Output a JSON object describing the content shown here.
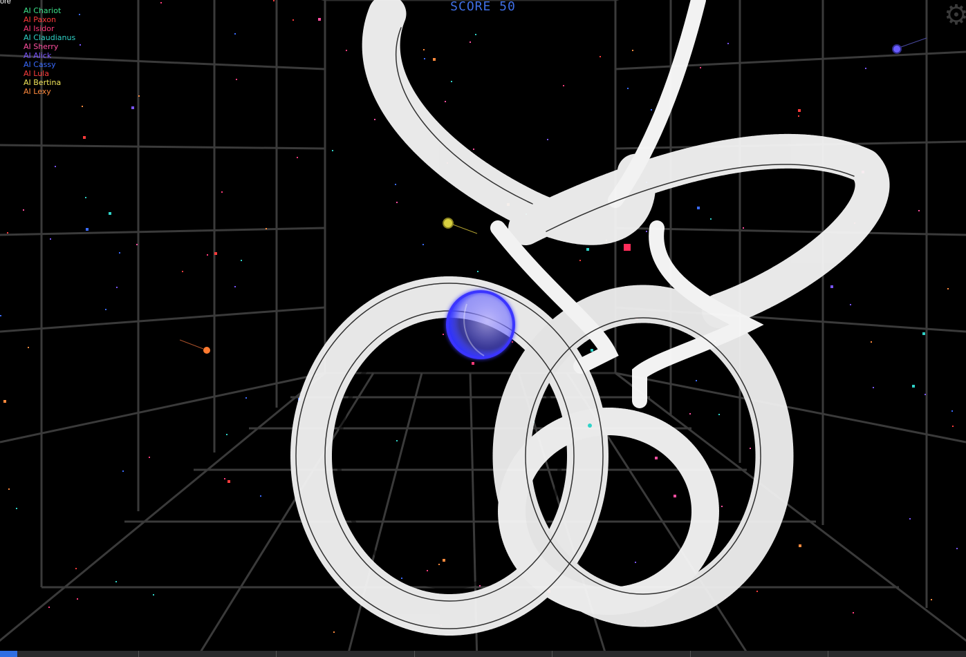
{
  "hud": {
    "score_text": "SCORE 50",
    "leaderboard_header": "ore",
    "settings_icon": "gear-icon"
  },
  "leaderboard": [
    {
      "name": "AI Chariot",
      "color": "#3de08a"
    },
    {
      "name": "AI Paxon",
      "color": "#ff3b3b"
    },
    {
      "name": "AI Isidor",
      "color": "#ff3b7a"
    },
    {
      "name": "AI Claudianus",
      "color": "#2fd3c8"
    },
    {
      "name": "AI Sherry",
      "color": "#ff4fa0"
    },
    {
      "name": "AI Alick",
      "color": "#7a55ff"
    },
    {
      "name": "AI Cassy",
      "color": "#3a6bff"
    },
    {
      "name": "AI Lula",
      "color": "#ff3d3d"
    },
    {
      "name": "AI Bertina",
      "color": "#f2e65a"
    },
    {
      "name": "AI Lexy",
      "color": "#ff8a3d"
    }
  ],
  "progress": {
    "fraction": 0.018,
    "segments": 7,
    "fill_color": "#2f6fe3"
  },
  "player_color": "#2a2fff"
}
